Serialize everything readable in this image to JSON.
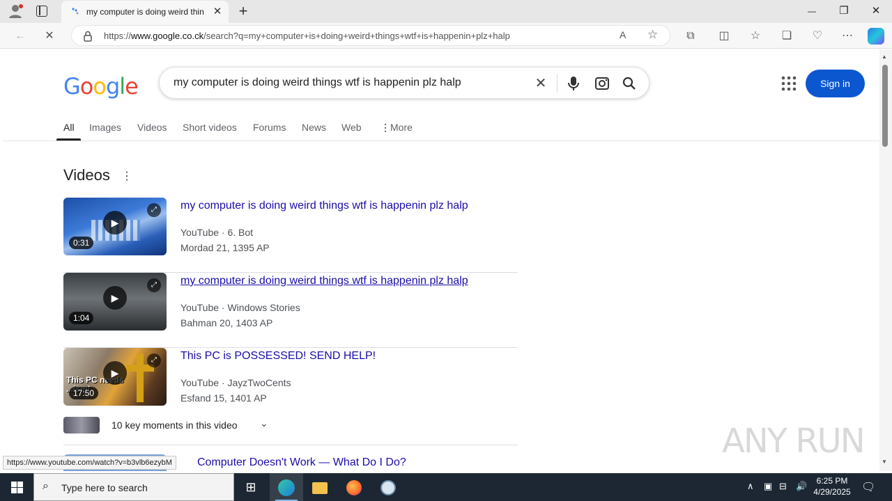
{
  "browser": {
    "tab_title": "my computer is doing weird thin",
    "tab_close": "✕",
    "window_controls": {
      "minimize": "—",
      "maximize": "❐",
      "close": "✕"
    },
    "new_tab": "+",
    "url_prefix": "https://",
    "url_domain": "www.google.co.ck",
    "url_rest": "/search?q=my+computer+is+doing+weird+things+wtf+is+happenin+plz+halp"
  },
  "google": {
    "query": "my computer is doing weird things wtf is happenin plz halp",
    "sign_in": "Sign in",
    "tabs": [
      "All",
      "Images",
      "Videos",
      "Short videos",
      "Forums",
      "News",
      "Web",
      "More"
    ],
    "videos_heading": "Videos",
    "videos": [
      {
        "title": "my computer is doing weird things wtf is happenin plz halp",
        "source": "YouTube · 6. Bot",
        "date": "Mordad 21, 1395 AP",
        "duration": "0:31"
      },
      {
        "title": "my computer is doing weird things wtf is happenin plz halp",
        "source": "YouTube · Windows Stories",
        "date": "Bahman 20, 1403 AP",
        "duration": "1:04"
      },
      {
        "title": "This PC is POSSESSED! SEND HELP!",
        "source": "YouTube · JayzTwoCents",
        "date": "Esfand 15, 1401 AP",
        "duration": "17:50"
      }
    ],
    "thumb3_text": "This PC needs ...ism!",
    "key_moments": "10 key moments in this video",
    "next_result_title": "Computer Doesn't Work — What Do I Do?",
    "status_url": "https://www.youtube.com/watch?v=b3vlb6ezybM"
  },
  "watermark": "ANY RUN",
  "taskbar": {
    "search_placeholder": "Type here to search",
    "time": "6:25 PM",
    "date": "4/29/2025"
  },
  "colors": {
    "google_blue": "#4285F4",
    "google_red": "#EA4335",
    "google_yellow": "#FBBC05",
    "google_green": "#34A853",
    "link": "#1a0dab",
    "sign_in_bg": "#0b57d0"
  }
}
